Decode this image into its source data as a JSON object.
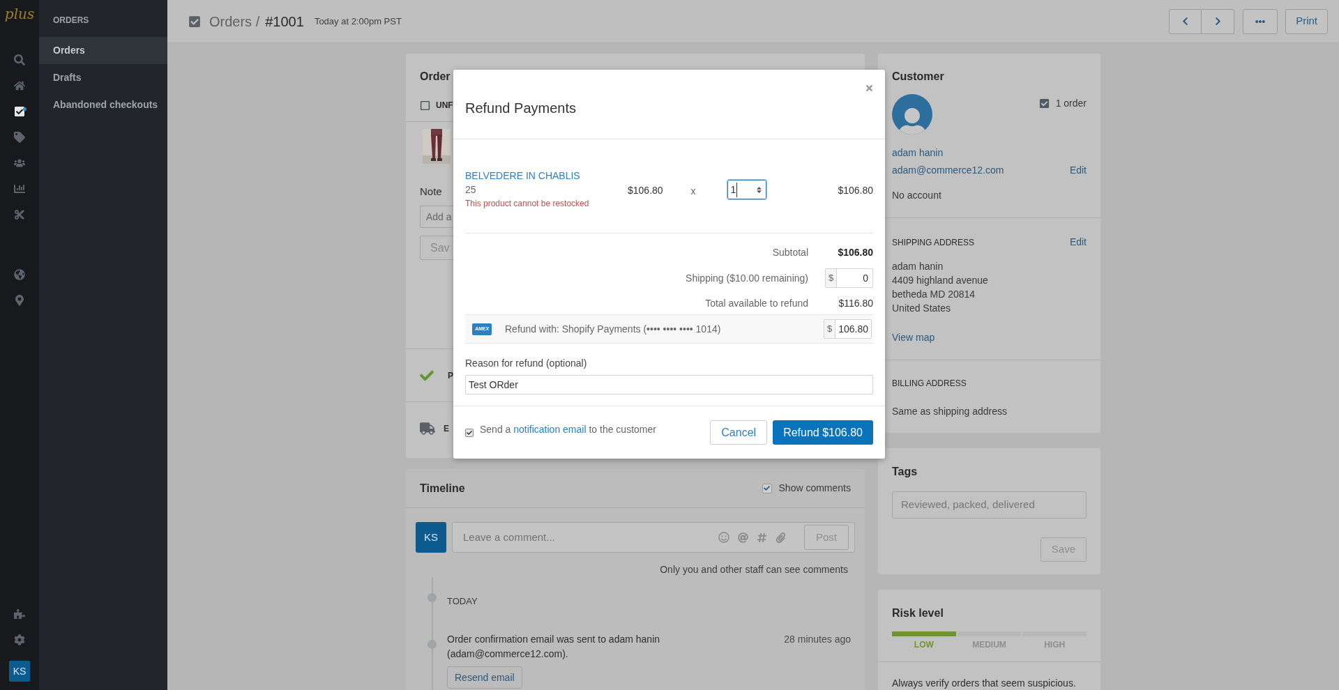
{
  "rail": {
    "logo": "plus",
    "top": [
      {
        "kind": "search",
        "selected": false,
        "badge": false
      },
      {
        "kind": "home",
        "selected": false,
        "badge": false
      },
      {
        "kind": "orders",
        "selected": true,
        "badge": true
      },
      {
        "kind": "products",
        "selected": false,
        "badge": false
      },
      {
        "kind": "customers",
        "selected": false,
        "badge": false
      },
      {
        "kind": "analytics",
        "selected": false,
        "badge": false
      },
      {
        "kind": "discounts",
        "selected": false,
        "badge": false
      }
    ],
    "middle": [
      {
        "kind": "globe",
        "selected": false,
        "badge": false
      },
      {
        "kind": "location",
        "selected": false,
        "badge": false
      }
    ],
    "bottom": [
      {
        "kind": "apps",
        "selected": false,
        "badge": false
      },
      {
        "kind": "settings",
        "selected": false,
        "badge": false
      }
    ],
    "avatar": "KS"
  },
  "sub_nav": {
    "title": "ORDERS",
    "items": [
      {
        "label": "Orders",
        "selected": true
      },
      {
        "label": "Drafts",
        "selected": false
      },
      {
        "label": "Abandoned checkouts",
        "selected": false
      }
    ]
  },
  "header": {
    "section": "Orders /",
    "order": "#1001",
    "time": "Today at 2:00pm PST",
    "print": "Print"
  },
  "order_card": {
    "title": "Order",
    "status": "UNF",
    "note_label": "Note",
    "note_placeholder": "Add a",
    "save": "Sav",
    "payment_row": "P",
    "fulfillment_row": "E"
  },
  "timeline": {
    "title": "Timeline",
    "show_comments": {
      "label": "Show comments",
      "checked": true
    },
    "avatar": "KS",
    "comment_placeholder": "Leave a comment...",
    "post": "Post",
    "hint": "Only you and other staff can see comments",
    "day": "TODAY",
    "events": [
      {
        "text": "Order confirmation email was sent to adam hanin (adam@commerce12.com).",
        "time": "28 minutes ago",
        "action": "Resend email"
      }
    ]
  },
  "customer": {
    "title": "Customer",
    "orders": "1 order",
    "name": "adam hanin",
    "email": "adam@commerce12.com",
    "edit": "Edit",
    "account": "No account",
    "shipping": {
      "title": "SHIPPING ADDRESS",
      "edit": "Edit",
      "lines": [
        "adam hanin",
        "4409 highland avenue",
        "betheda MD 20814",
        "United States"
      ],
      "map": "View map"
    },
    "billing": {
      "title": "BILLING ADDRESS",
      "text": "Same as shipping address"
    }
  },
  "tags": {
    "title": "Tags",
    "placeholder": "Reviewed, packed, delivered",
    "save": "Save"
  },
  "risk": {
    "title": "Risk level",
    "levels": [
      {
        "label": "LOW",
        "selected": true
      },
      {
        "label": "MEDIUM",
        "selected": false
      },
      {
        "label": "HIGH",
        "selected": false
      }
    ],
    "note": "Always verify orders that seem suspicious."
  },
  "modal": {
    "title": "Refund Payments",
    "item": {
      "name": "BELVEDERE IN CHABLIS",
      "variant": "25",
      "warning": "This product cannot be restocked",
      "price": "$106.80",
      "times": "x",
      "quantity": "1",
      "total": "$106.80"
    },
    "subtotal": {
      "label": "Subtotal",
      "value": "$106.80"
    },
    "shipping": {
      "label": "Shipping ($10.00 remaining)",
      "currency": "$",
      "value": "0"
    },
    "available": {
      "label": "Total available to refund",
      "value": "$116.80"
    },
    "refund_with": {
      "card": "AMEX",
      "label": "Refund with: Shopify Payments (•••• •••• •••• 1014)",
      "currency": "$",
      "value": "106.80"
    },
    "reason": {
      "label": "Reason for refund (optional)",
      "value": "Test ORder"
    },
    "notify": {
      "checked": true,
      "before": "Send a",
      "link": "notification email",
      "after": "to the customer"
    },
    "cancel": "Cancel",
    "refund": "Refund $106.80"
  }
}
